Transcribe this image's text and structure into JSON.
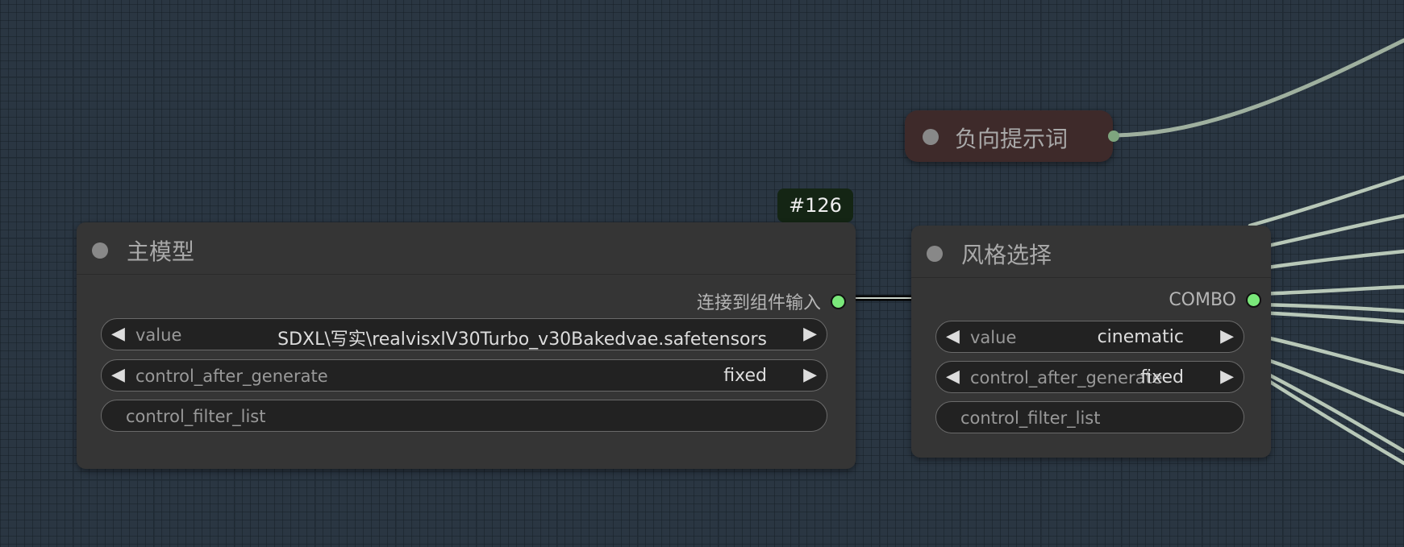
{
  "badge": {
    "label": "#126"
  },
  "negative_prompt_node": {
    "title": "负向提示词"
  },
  "main_model_node": {
    "title": "主模型",
    "output_label": "连接到组件输入",
    "widgets": {
      "value": {
        "label": "value",
        "value": "SDXL\\写实\\realvisxlV30Turbo_v30Bakedvae.safetensors"
      },
      "control_after_generate": {
        "label": "control_after_generate",
        "value": "fixed"
      },
      "control_filter_list": {
        "label": "control_filter_list"
      }
    }
  },
  "style_select_node": {
    "title": "风格选择",
    "output_label": "COMBO",
    "widgets": {
      "value": {
        "label": "value",
        "value": "cinematic"
      },
      "control_after_generate": {
        "label": "control_after_generate",
        "value": "fixed"
      },
      "control_filter_list": {
        "label": "control_filter_list"
      }
    }
  },
  "icons": {
    "arrow_left": "◀",
    "arrow_right": "▶"
  },
  "colors": {
    "canvas": "#2a3642",
    "node": "#353535",
    "output_dot": "#7ae87a",
    "wire": "#b8c8b8",
    "badge": "#142514",
    "pill": "#3e2a2a"
  }
}
